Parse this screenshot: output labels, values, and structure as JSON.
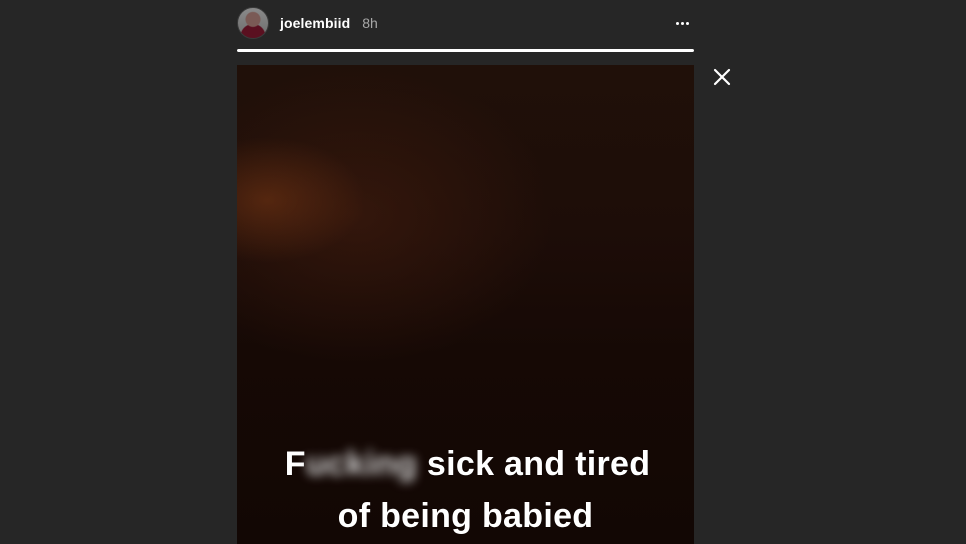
{
  "story": {
    "username": "joelembiid",
    "time_ago": "8h",
    "progress": 1.0,
    "caption_line1_first": "F",
    "caption_line1_blurred": "ucking",
    "caption_line1_rest": " sick and tired",
    "caption_line2": "of being babied"
  },
  "icons": {
    "more": "more-options-icon",
    "close": "close-icon"
  },
  "colors": {
    "background": "#262626",
    "text": "#ffffff",
    "muted": "#a8a8a8"
  }
}
